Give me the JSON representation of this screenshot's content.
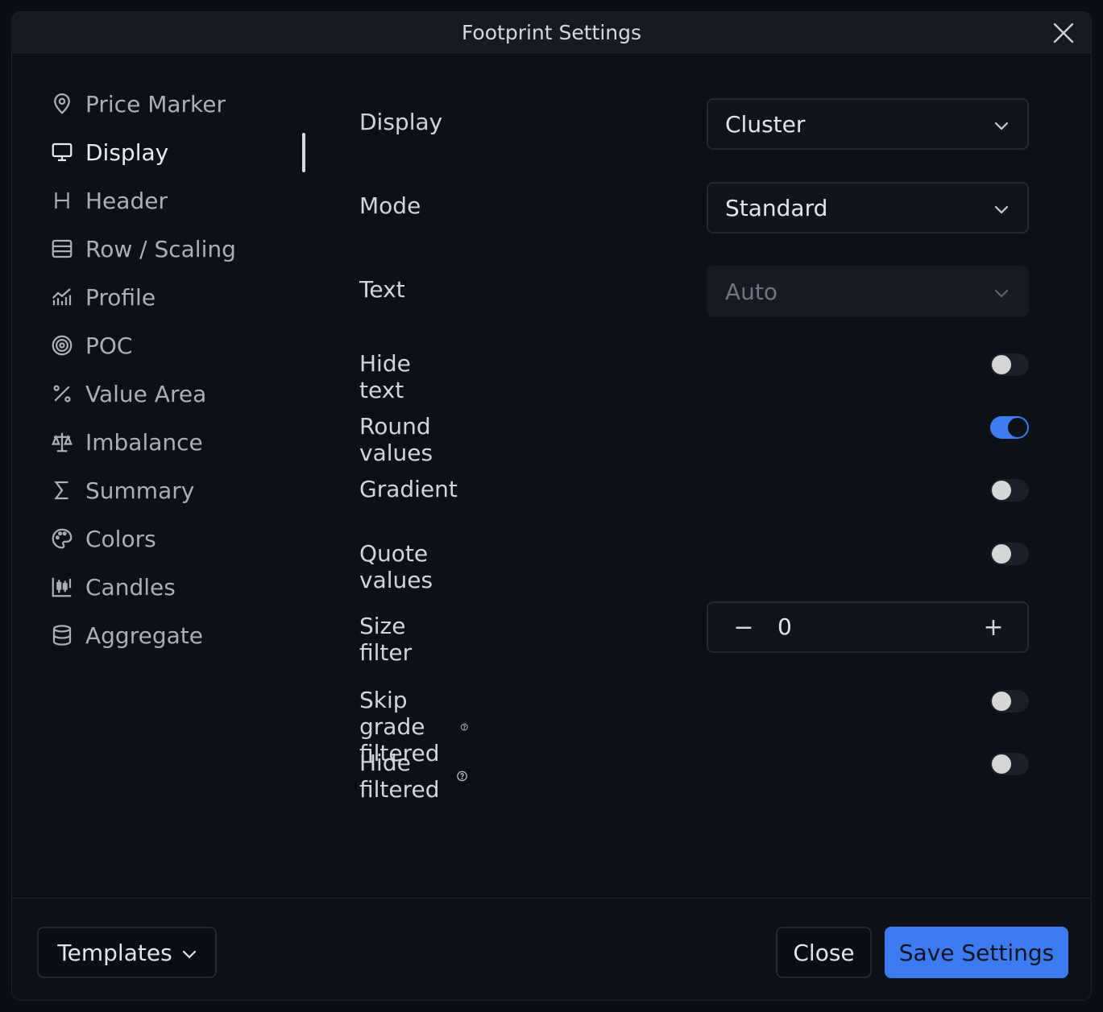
{
  "window": {
    "title": "Footprint Settings"
  },
  "sidebar": {
    "items": [
      {
        "label": "Price Marker",
        "icon": "map-pin-icon"
      },
      {
        "label": "Display",
        "icon": "monitor-icon",
        "active": true
      },
      {
        "label": "Header",
        "icon": "heading-icon"
      },
      {
        "label": "Row / Scaling",
        "icon": "rows-icon"
      },
      {
        "label": "Profile",
        "icon": "chart-bars-icon"
      },
      {
        "label": "POC",
        "icon": "target-icon"
      },
      {
        "label": "Value Area",
        "icon": "percent-icon"
      },
      {
        "label": "Imbalance",
        "icon": "scale-icon"
      },
      {
        "label": "Summary",
        "icon": "sigma-icon"
      },
      {
        "label": "Colors",
        "icon": "palette-icon"
      },
      {
        "label": "Candles",
        "icon": "candles-icon"
      },
      {
        "label": "Aggregate",
        "icon": "database-icon"
      }
    ]
  },
  "settings": {
    "display": {
      "label": "Display",
      "value": "Cluster"
    },
    "mode": {
      "label": "Mode",
      "value": "Standard"
    },
    "text": {
      "label": "Text",
      "value": "Auto",
      "disabled": true
    },
    "hide_text": {
      "label": "Hide text",
      "on": false
    },
    "round_values": {
      "label": "Round values",
      "on": true
    },
    "gradient": {
      "label": "Gradient",
      "on": false
    },
    "quote_values": {
      "label": "Quote values",
      "on": false
    },
    "size_filter": {
      "label": "Size filter",
      "value": "0",
      "minus": "−",
      "plus": "+"
    },
    "skip_grade_filtered": {
      "label": "Skip grade filtered",
      "on": false
    },
    "hide_filtered": {
      "label": "Hide filtered",
      "on": false
    }
  },
  "footer": {
    "templates_label": "Templates",
    "close_label": "Close",
    "save_label": "Save Settings"
  },
  "colors": {
    "accent": "#3d7bf2",
    "background": "#0c1017"
  }
}
